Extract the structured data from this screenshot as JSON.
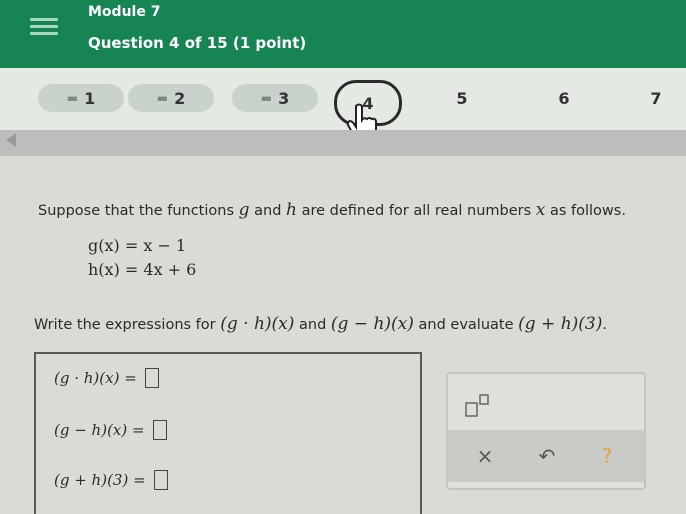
{
  "header": {
    "module": "Module 7",
    "question_count": "Question 4 of 15 (1 point)"
  },
  "nav": {
    "answered_mark": "▬",
    "items": [
      {
        "label": "1",
        "state": "answered"
      },
      {
        "label": "2",
        "state": "answered"
      },
      {
        "label": "3",
        "state": "answered"
      },
      {
        "label": "4",
        "state": "current"
      },
      {
        "label": "5",
        "state": "unanswered"
      },
      {
        "label": "6",
        "state": "unanswered"
      },
      {
        "label": "7",
        "state": "unanswered"
      }
    ]
  },
  "question": {
    "prompt_before": "Suppose that the functions ",
    "g": "g",
    "prompt_and": " and ",
    "h": "h",
    "prompt_mid": " are defined for all real numbers ",
    "x": "x",
    "prompt_after": " as follows.",
    "def_g": "g(x) = x − 1",
    "def_h": "h(x) = 4x + 6",
    "instr_before": "Write the expressions for ",
    "expr1": "(g · h)(x)",
    "instr_and": " and ",
    "expr2": "(g − h)(x)",
    "instr_mid": " and evaluate ",
    "expr3": "(g + h)(3)",
    "instr_end": "."
  },
  "answers": [
    {
      "lhs": "(g · h)(x)",
      "eq": "="
    },
    {
      "lhs": "(g − h)(x)",
      "eq": "="
    },
    {
      "lhs": "(g + h)(3)",
      "eq": "="
    }
  ],
  "tools": {
    "clear_symbol": "×",
    "undo_symbol": "↶",
    "help_symbol": "?"
  },
  "colors": {
    "header": "#168553",
    "help": "#e8a33a"
  }
}
